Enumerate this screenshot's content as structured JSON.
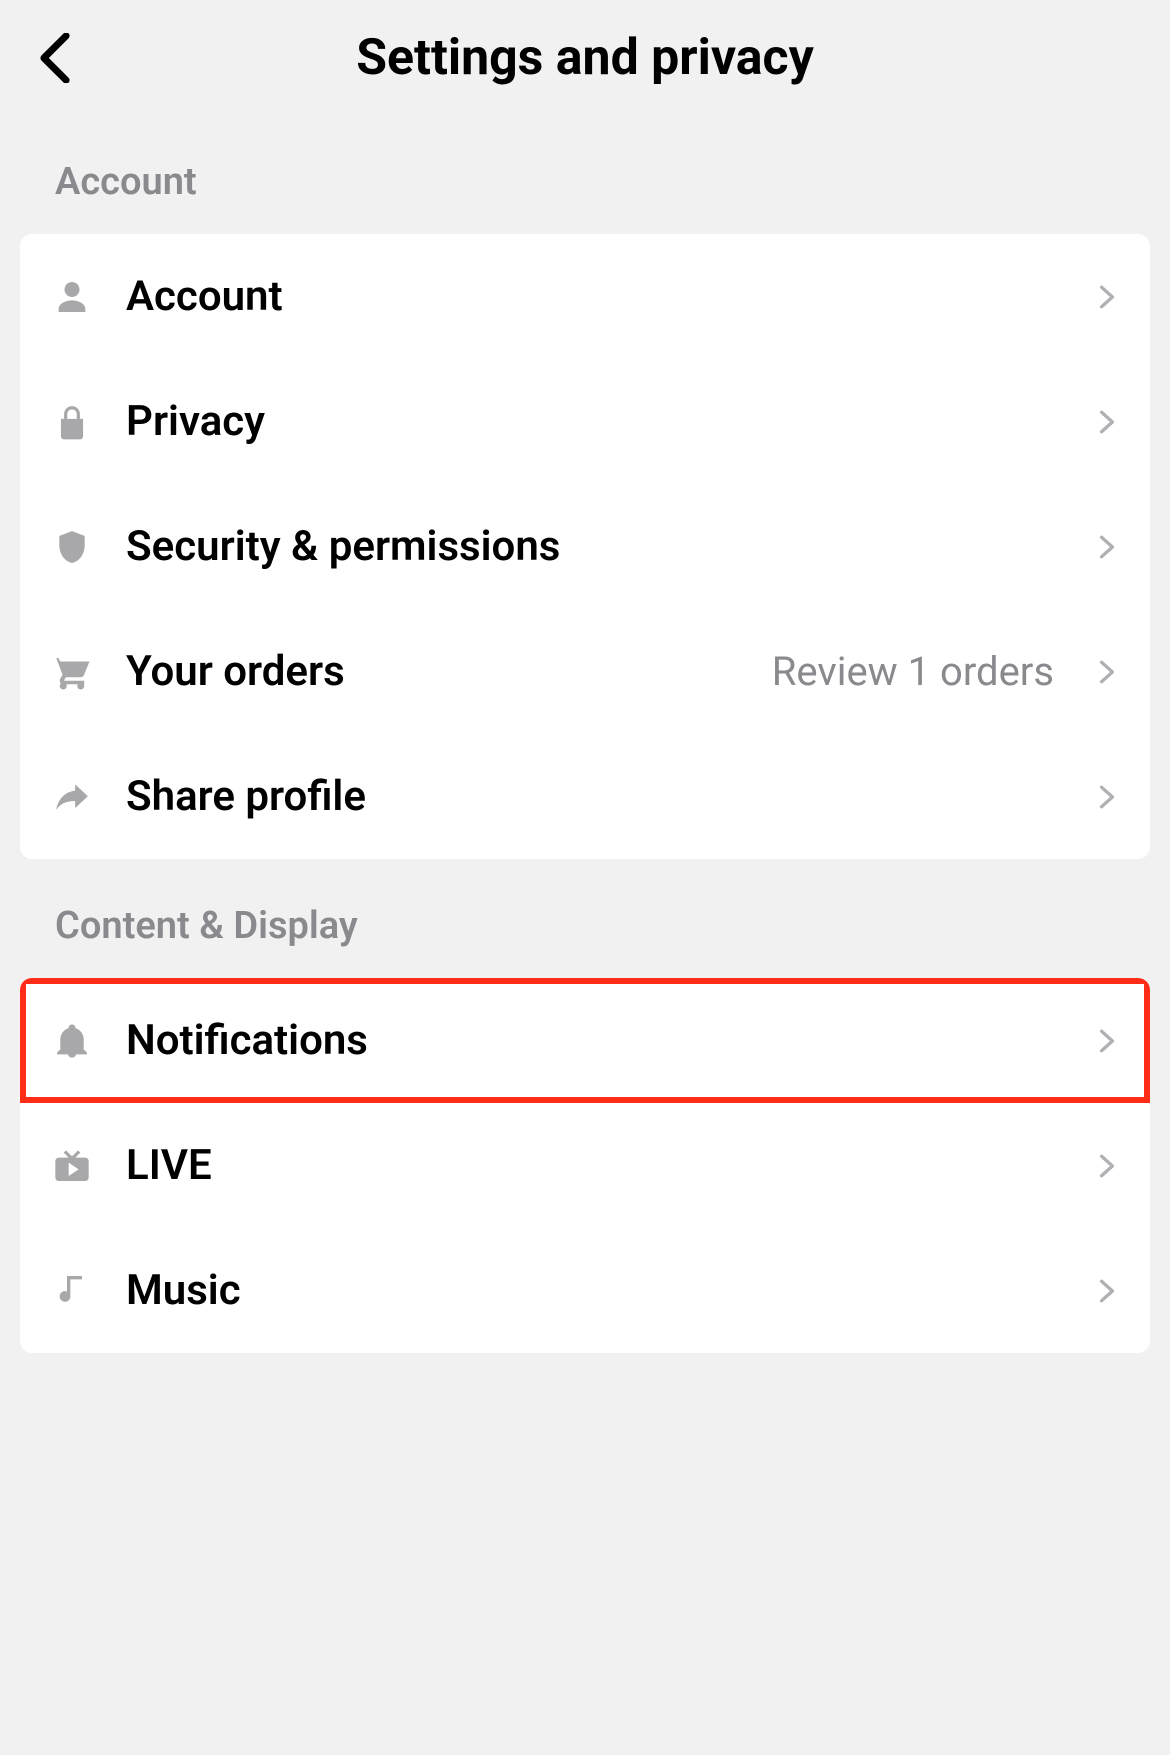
{
  "header": {
    "title": "Settings and privacy"
  },
  "sections": {
    "account": {
      "heading": "Account",
      "items": {
        "account": {
          "label": "Account"
        },
        "privacy": {
          "label": "Privacy"
        },
        "security": {
          "label": "Security & permissions"
        },
        "orders": {
          "label": "Your orders",
          "detail": "Review 1 orders"
        },
        "share": {
          "label": "Share profile"
        }
      }
    },
    "content": {
      "heading": "Content & Display",
      "items": {
        "notifications": {
          "label": "Notifications"
        },
        "live": {
          "label": "LIVE"
        },
        "music": {
          "label": "Music"
        }
      }
    }
  }
}
